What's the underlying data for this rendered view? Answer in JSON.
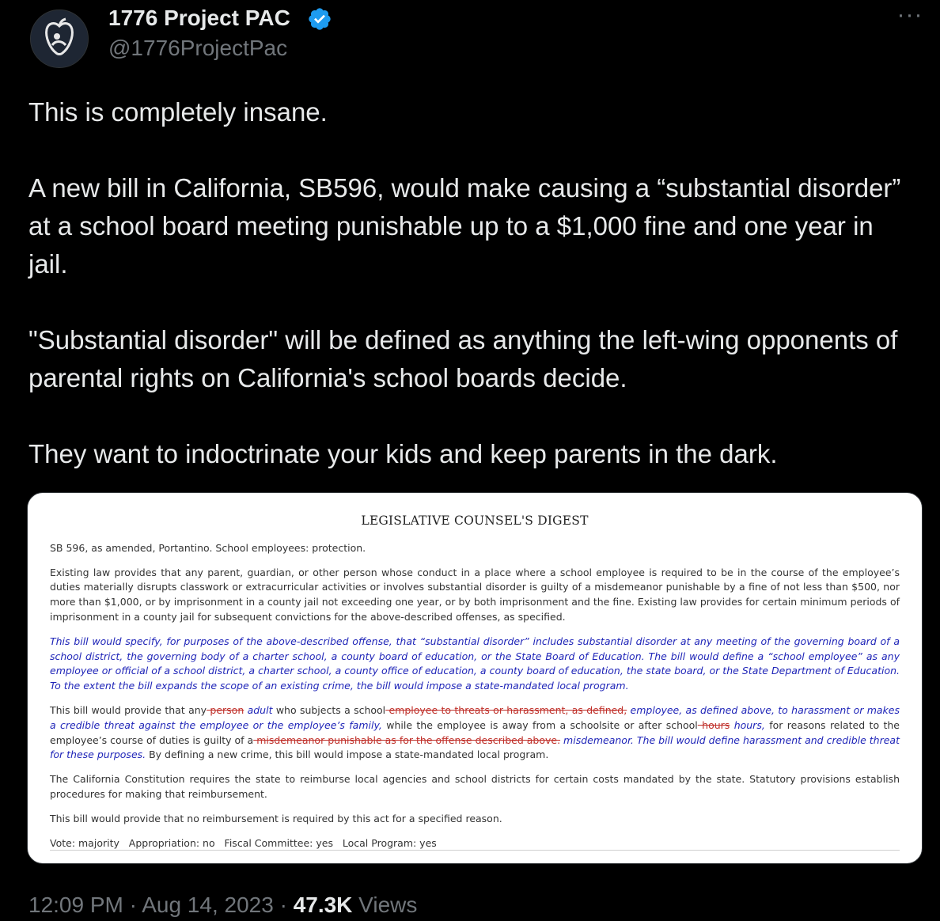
{
  "author": {
    "name": "1776 Project PAC",
    "handle": "@1776ProjectPac"
  },
  "tweet": {
    "text": "This is completely insane.\n\nA new bill in California, SB596, would make causing a “substantial disorder” at a school board meeting punishable up to a $1,000 fine and one year in jail.\n\n\"Substantial disorder\" will be defined as anything the left-wing opponents of parental rights on California's school boards decide.\n\nThey want to indoctrinate your kids and keep parents in the dark."
  },
  "document": {
    "title": "LEGISLATIVE COUNSEL'S DIGEST",
    "heading": "SB 596, as amended, Portantino. School employees: protection.",
    "para1": "Existing law provides that any parent, guardian, or other person whose conduct in a place where a school employee is required to be in the course of the employee’s duties materially disrupts classwork or extracurricular activities or involves substantial disorder is guilty of a misdemeanor punishable by a fine of not less than $500, nor more than $1,000, or by imprisonment in a county jail not exceeding one year, or by both imprisonment and the fine. Existing law provides for certain minimum periods of imprisonment in a county jail for subsequent convictions for the above-described offenses, as specified.",
    "para2": "This bill would specify, for purposes of the above-described offense, that “substantial disorder” includes substantial disorder at any meeting of the governing board of a school district, the governing body of a charter school, a county board of education, or the State Board of Education. The bill would define a “school employee” as any employee or official of a school district, a charter school, a county office of education, a county board of education, the state board, or the State Department of Education. To the extent the bill expands the scope of an existing crime, the bill would impose a state-mandated local program.",
    "para3": {
      "t1": "This bill would provide that any",
      "del1": " person",
      "ins1": " adult",
      "t2": " who subjects a school",
      "del2": " employee to threats or harassment, as defined,",
      "ins2": " employee, as defined above, to harassment or makes a credible threat against the employee or the employee’s family,",
      "t3": " while the employee is away from a schoolsite or after school",
      "del3": " hours",
      "ins3": " hours,",
      "t4": " for reasons related to the employee’s course of duties is guilty of a",
      "del4": " misdemeanor punishable as for the offense described above.",
      "ins4": " misdemeanor. The bill would define harassment and credible threat for these purposes.",
      "t5": " By defining a new crime, this bill would impose a state-mandated local program."
    },
    "para4": "The California Constitution requires the state to reimburse local agencies and school districts for certain costs mandated by the state. Statutory provisions establish procedures for making that reimbursement.",
    "para5": "This bill would provide that no reimbursement is required by this act for a specified reason.",
    "votes": "Vote: majority   Appropriation: no   Fiscal Committee: yes   Local Program: yes"
  },
  "meta": {
    "time": "12:09 PM",
    "sep1": " · ",
    "date": "Aug 14, 2023",
    "sep2": " · ",
    "views_count": "47.3K",
    "views_label": " Views"
  },
  "icons": {
    "verified_color": "#1d9bf0"
  }
}
